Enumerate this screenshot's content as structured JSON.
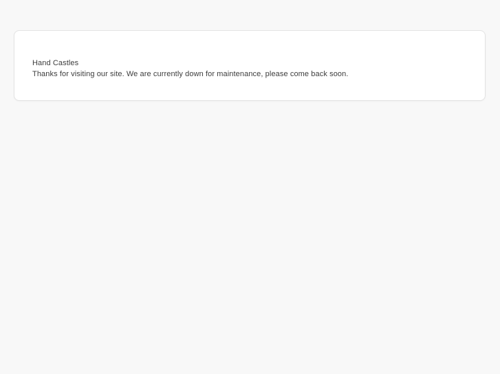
{
  "page": {
    "background_color": "#f8f8f8"
  },
  "card": {
    "title": "Hand Castles",
    "message": "Thanks for visiting our site. We are currently down for maintenance, please come back soon.",
    "background_color": "#ffffff",
    "border_color": "#e3e3e3",
    "text_color": "#3c3c3c"
  }
}
